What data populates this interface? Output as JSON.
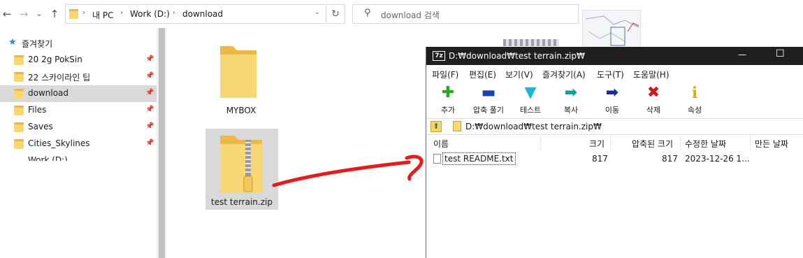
{
  "explorer": {
    "nav": {
      "back": "←",
      "forward": "→",
      "dropdown": "⌄",
      "up": "↑"
    },
    "breadcrumb": [
      "내 PC",
      "Work (D:)",
      "download"
    ],
    "search_placeholder": "download 검색",
    "refresh": "↻",
    "sidebar": {
      "quick_access": "즐겨찾기",
      "items": [
        {
          "label": "20 2g PokSin"
        },
        {
          "label": "22 스카이라인 팁"
        },
        {
          "label": "download"
        },
        {
          "label": "Files"
        },
        {
          "label": "Saves"
        },
        {
          "label": "Cities_Skylines"
        },
        {
          "label": "Work (D:)"
        }
      ]
    },
    "files": [
      {
        "name": "MYBOX",
        "type": "folder"
      },
      {
        "name": "test terrain.zip",
        "type": "zip"
      }
    ]
  },
  "sevenzip": {
    "title": "D:₩download₩test terrain.zip₩",
    "app_icon_text": "7z",
    "window_controls": {
      "minimize": "—",
      "maximize": "☐"
    },
    "menu": [
      "파일(F)",
      "편집(E)",
      "보기(V)",
      "즐겨찾기(A)",
      "도구(T)",
      "도움말(H)"
    ],
    "toolbar": [
      {
        "label": "추가",
        "icon": "add-icon",
        "glyph": "✚",
        "color": "#22aa22"
      },
      {
        "label": "압축 풀기",
        "icon": "extract-icon",
        "glyph": "▬",
        "color": "#1a3fb5"
      },
      {
        "label": "테스트",
        "icon": "test-icon",
        "glyph": "▼",
        "color": "#19b7d6"
      },
      {
        "label": "복사",
        "icon": "copy-icon",
        "glyph": "➡",
        "color": "#1a9a9a"
      },
      {
        "label": "이동",
        "icon": "move-icon",
        "glyph": "➡",
        "color": "#1a2a9a"
      },
      {
        "label": "삭제",
        "icon": "delete-icon",
        "glyph": "✖",
        "color": "#d01818"
      },
      {
        "label": "속성",
        "icon": "info-icon",
        "glyph": "i",
        "color": "#d6b400"
      }
    ],
    "path": "D:₩download₩test terrain.zip₩",
    "columns": [
      "이름",
      "크기",
      "압축된 크기",
      "수정한 날짜",
      "만든 날짜"
    ],
    "rows": [
      {
        "name": "test README.txt",
        "size": "817",
        "packed": "817",
        "modified": "2023-12-26 1..."
      }
    ]
  }
}
